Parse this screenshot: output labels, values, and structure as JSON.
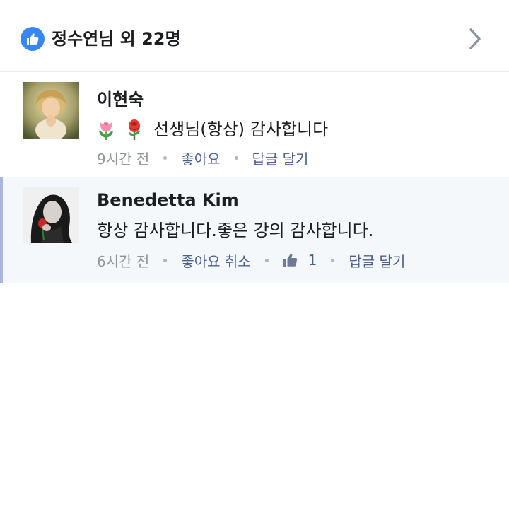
{
  "header": {
    "title": "정수연님 외 22명",
    "icon": "like-thumb-icon",
    "accent": "#3b86f7"
  },
  "comments": [
    {
      "author": "이현숙",
      "avatar": "child-praying-photo",
      "emojis": [
        "tulip-icon",
        "rose-icon"
      ],
      "text": "선생님(항상) 감사합니다",
      "time": "9시간 전",
      "like_label": "좋아요",
      "reply_label": "답글 달기"
    },
    {
      "author": "Benedetta Kim",
      "avatar": "woman-with-rose-photo",
      "text": "항상 감사합니다.좋은 강의 감사합니다.",
      "time": "6시간 전",
      "like_label": "좋아요 취소",
      "like_count": "1",
      "reply_label": "답글 달기",
      "highlight_color": "#f5f8fb",
      "bar_color": "#a8b7dc"
    }
  ]
}
